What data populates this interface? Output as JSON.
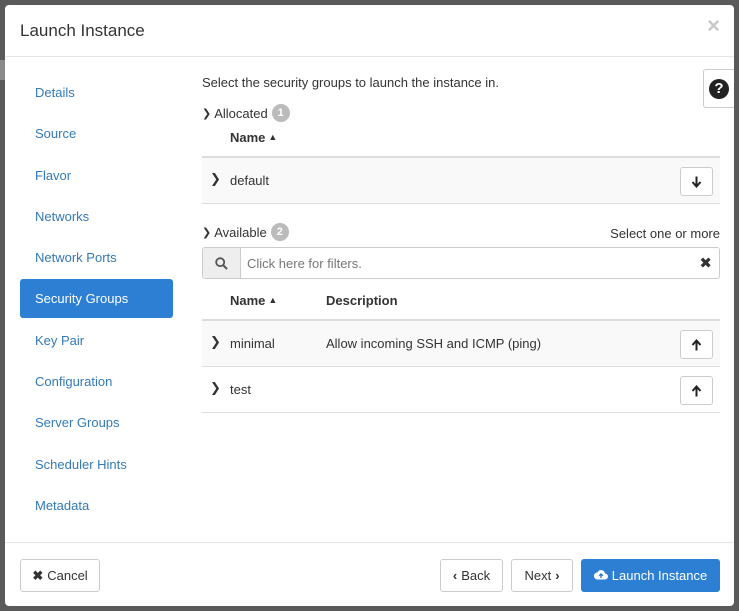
{
  "modal": {
    "title": "Launch Instance",
    "close_glyph": "×"
  },
  "sidebar": {
    "items": [
      {
        "label": "Details"
      },
      {
        "label": "Source"
      },
      {
        "label": "Flavor"
      },
      {
        "label": "Networks"
      },
      {
        "label": "Network Ports"
      },
      {
        "label": "Security Groups",
        "active": true
      },
      {
        "label": "Key Pair"
      },
      {
        "label": "Configuration"
      },
      {
        "label": "Server Groups"
      },
      {
        "label": "Scheduler Hints"
      },
      {
        "label": "Metadata"
      }
    ]
  },
  "help": {
    "glyph": "?"
  },
  "security_groups": {
    "intro": "Select the security groups to launch the instance in.",
    "allocated": {
      "label": "Allocated",
      "count": "1",
      "columns": {
        "name": "Name"
      },
      "rows": [
        {
          "name": "default",
          "action_icon": "arrow-down-icon"
        }
      ]
    },
    "available": {
      "label": "Available",
      "count": "2",
      "hint": "Select one or more",
      "filter_placeholder": "Click here for filters.",
      "columns": {
        "name": "Name",
        "description": "Description"
      },
      "rows": [
        {
          "name": "minimal",
          "description": "Allow incoming SSH and ICMP (ping)",
          "action_icon": "arrow-up-icon"
        },
        {
          "name": "test",
          "description": "",
          "action_icon": "arrow-up-icon"
        }
      ]
    }
  },
  "footer": {
    "cancel_label": "Cancel",
    "back_label": "Back",
    "next_label": "Next",
    "launch_label": "Launch Instance"
  },
  "colors": {
    "accent": "#2c7fd2",
    "link": "#337ab7",
    "badge": "#bbbbbb",
    "backdrop": "#5a5a5a"
  }
}
